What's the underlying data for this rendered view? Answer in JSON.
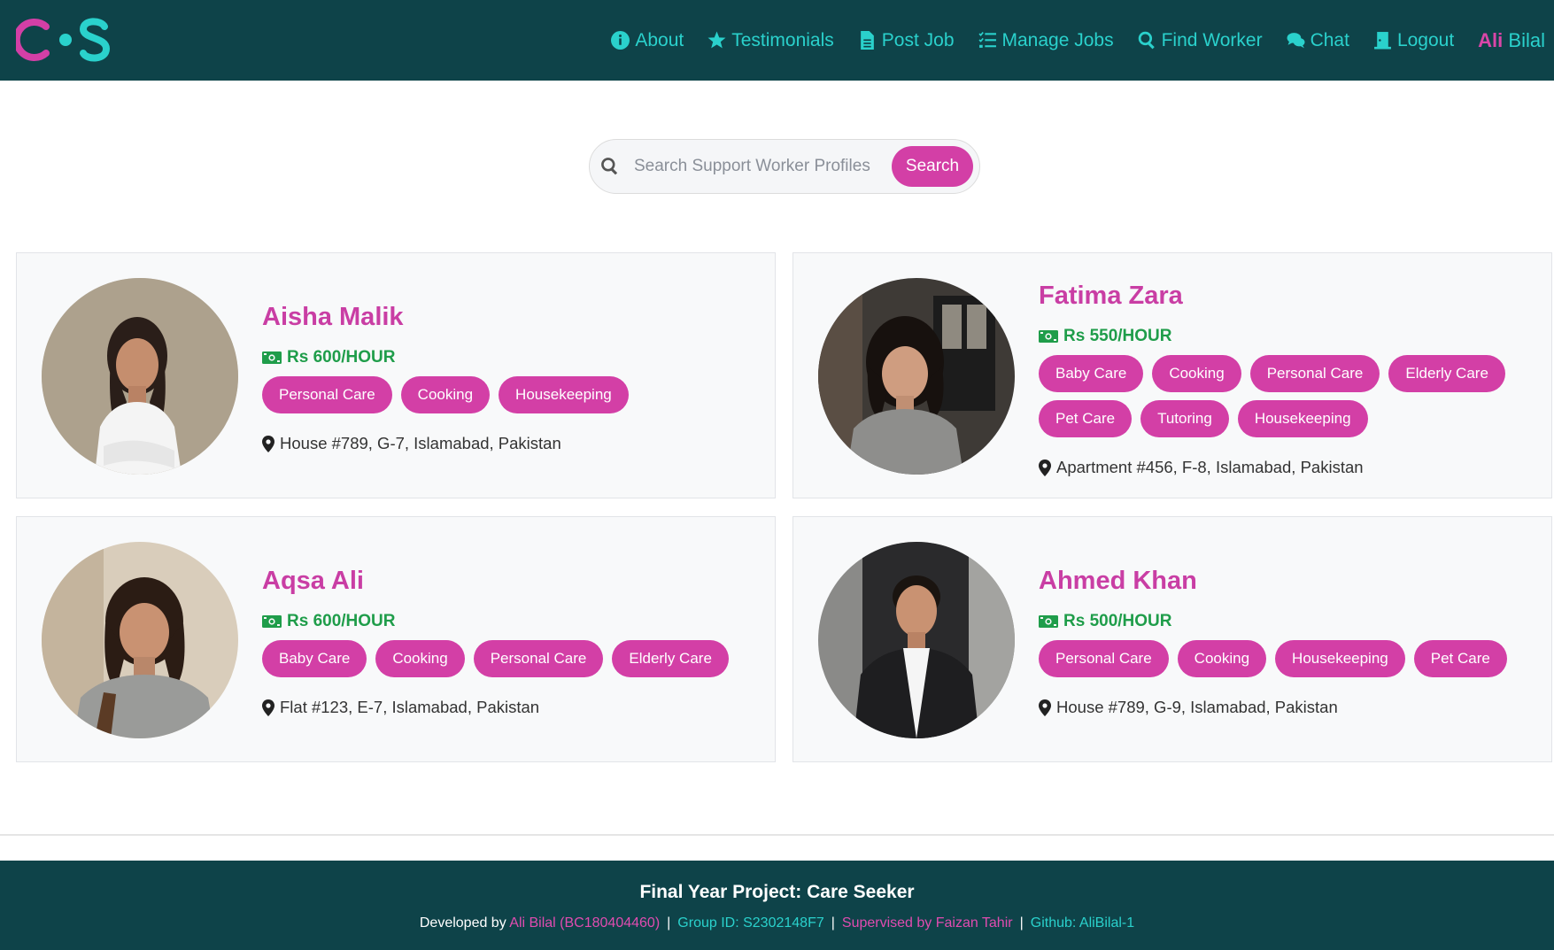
{
  "nav": {
    "items": [
      {
        "label": "About",
        "icon": "info-circle-icon"
      },
      {
        "label": "Testimonials",
        "icon": "star-icon"
      },
      {
        "label": "Post Job",
        "icon": "document-icon"
      },
      {
        "label": "Manage Jobs",
        "icon": "list-check-icon"
      },
      {
        "label": "Find Worker",
        "icon": "search-icon"
      },
      {
        "label": "Chat",
        "icon": "chat-bubbles-icon"
      },
      {
        "label": "Logout",
        "icon": "door-exit-icon"
      }
    ],
    "user_first": "Ali",
    "user_last": "Bilal"
  },
  "search": {
    "placeholder": "Search Support Worker Profiles",
    "button_label": "Search"
  },
  "workers": [
    {
      "name": "Aisha Malik",
      "rate": "Rs 600/HOUR",
      "tags": [
        "Personal Care",
        "Cooking",
        "Housekeeping"
      ],
      "address": "House #789, G-7, Islamabad, Pakistan"
    },
    {
      "name": "Fatima Zara",
      "rate": "Rs 550/HOUR",
      "tags": [
        "Baby Care",
        "Cooking",
        "Personal Care",
        "Elderly Care",
        "Pet Care",
        "Tutoring",
        "Housekeeping"
      ],
      "address": "Apartment #456, F-8, Islamabad, Pakistan"
    },
    {
      "name": "Aqsa Ali",
      "rate": "Rs 600/HOUR",
      "tags": [
        "Baby Care",
        "Cooking",
        "Personal Care",
        "Elderly Care"
      ],
      "address": "Flat #123, E-7, Islamabad, Pakistan"
    },
    {
      "name": "Ahmed Khan",
      "rate": "Rs 500/HOUR",
      "tags": [
        "Personal Care",
        "Cooking",
        "Housekeeping",
        "Pet Care"
      ],
      "address": "House #789, G-9, Islamabad, Pakistan"
    }
  ],
  "footer": {
    "title": "Final Year Project: Care Seeker",
    "developed_prefix": "Developed by ",
    "developer": "Ali Bilal (BC180404460)",
    "separator": "|",
    "group": "Group ID: S2302148F7",
    "supervisor": "Supervised by Faizan Tahir",
    "github": "Github: AliBilal-1"
  },
  "colors": {
    "header_bg": "#0e4349",
    "accent_teal": "#2ad1cc",
    "accent_pink": "#d33fa6",
    "rate_green": "#1f9d4a"
  }
}
